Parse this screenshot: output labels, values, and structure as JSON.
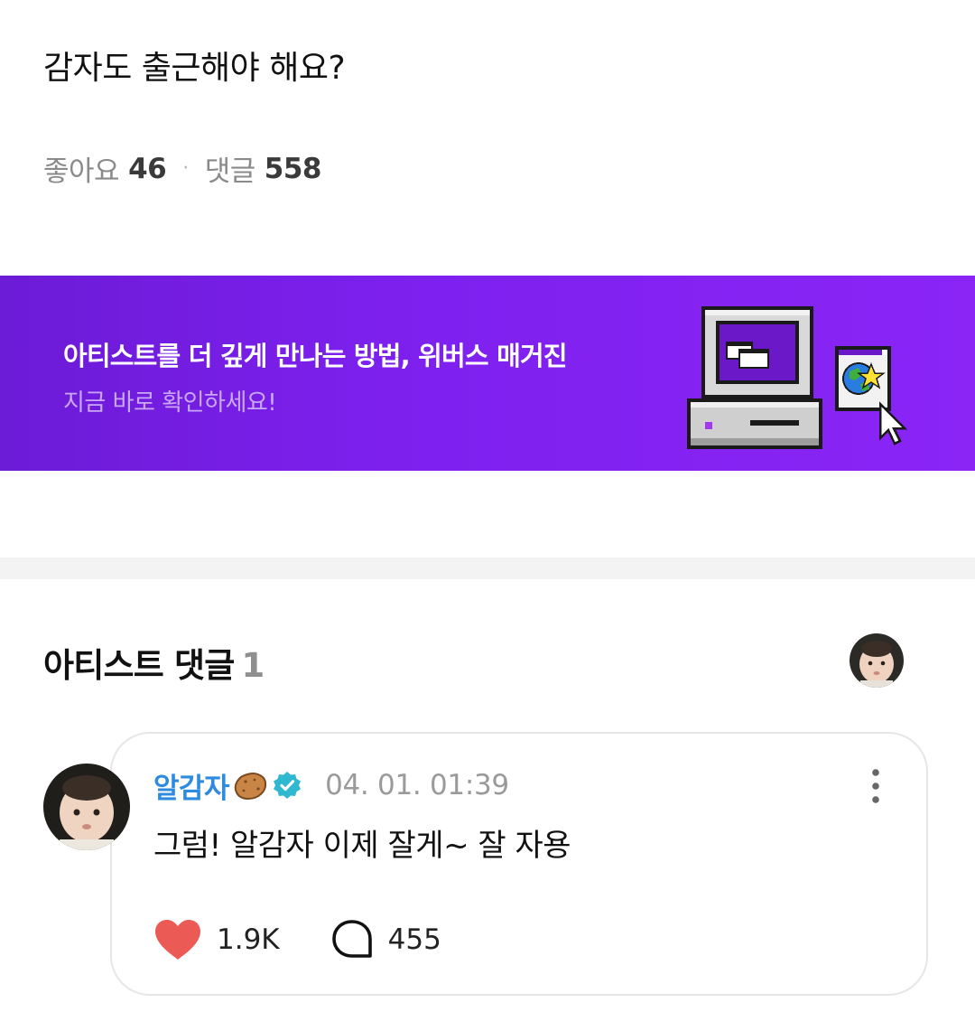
{
  "post": {
    "title": "감자도 출근해야 해요?",
    "likes_label": "좋아요",
    "likes_count": "46",
    "separator": "·",
    "comments_label": "댓글",
    "comments_count": "558"
  },
  "banner": {
    "title": "아티스트를 더 깊게 만나는 방법, 위버스 매거진",
    "subtitle": "지금 바로 확인하세요!",
    "bg_color": "#7d20ee"
  },
  "artist_comments": {
    "heading": "아티스트 댓글",
    "count": "1"
  },
  "comment": {
    "author": "알감자",
    "author_color": "#2f8be0",
    "badge_icon": "verified-badge-icon",
    "emoji_icon": "potato-icon",
    "timestamp": "04. 01. 01:39",
    "text": "그럼! 알감자 이제 잘게~ 잘 자용",
    "like_count": "1.9K",
    "reply_count": "455",
    "heart_color": "#ec5a55"
  }
}
